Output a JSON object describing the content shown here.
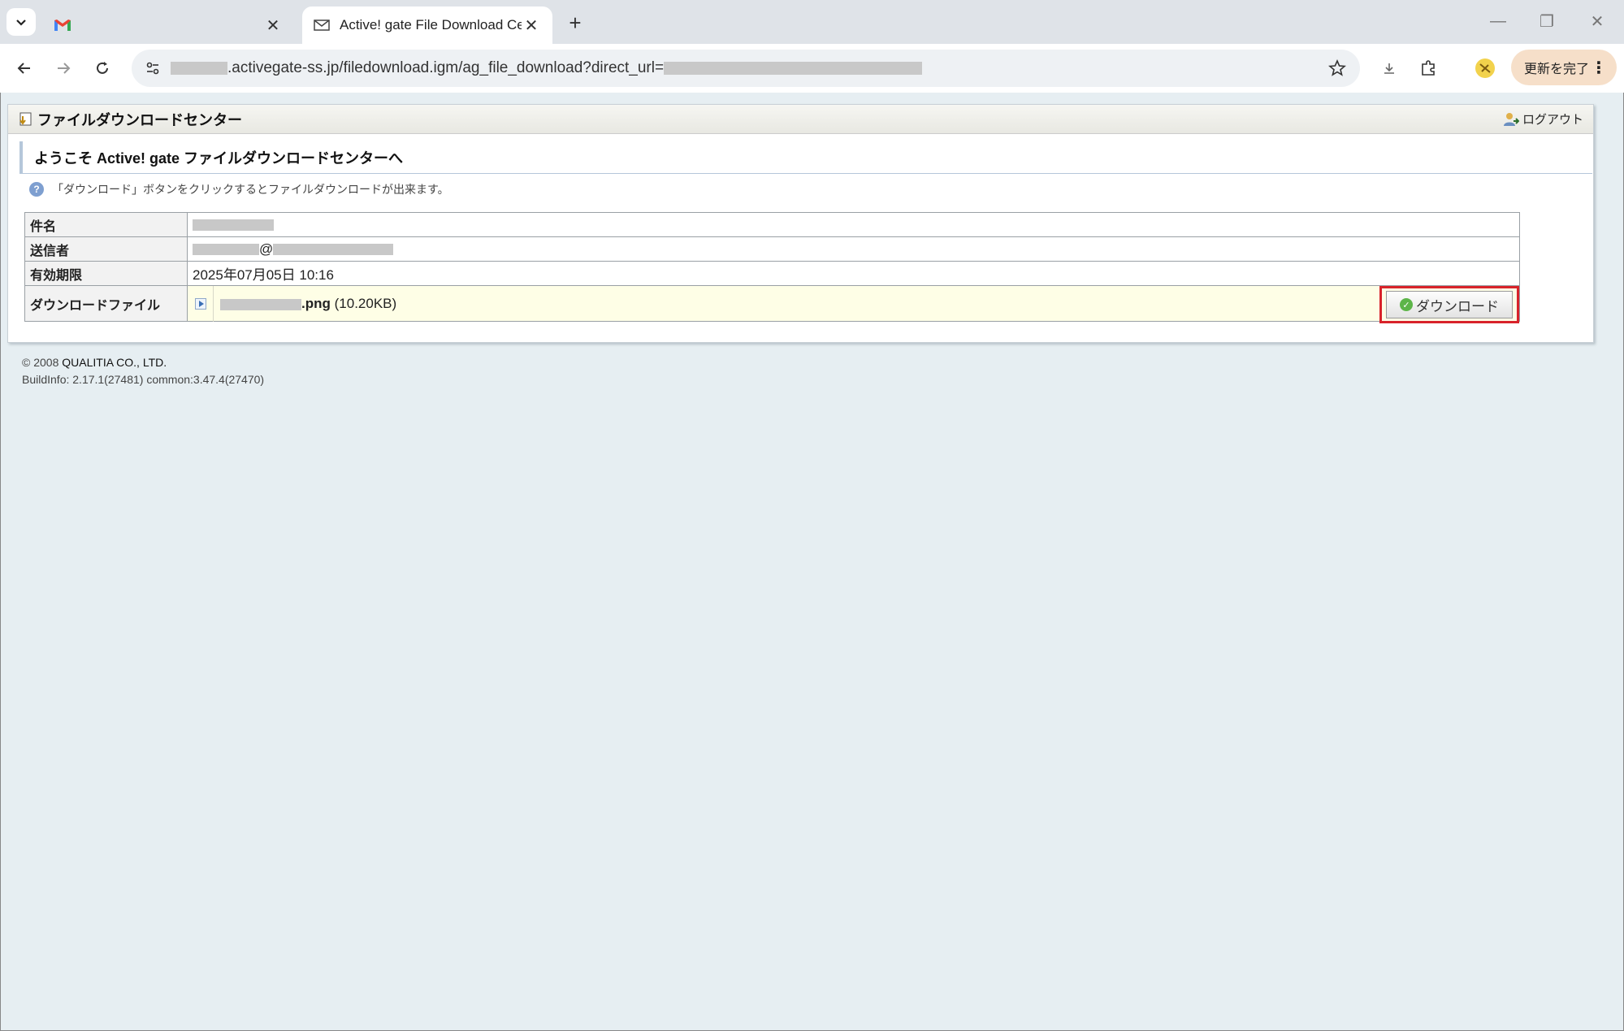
{
  "browser": {
    "tabs": [
      {
        "title": "",
        "icon": "gmail-icon"
      },
      {
        "title": "Active! gate File Download Cen",
        "icon": "mail-icon"
      }
    ],
    "url_domain": ".activegate-ss.jp/filedownload.igm/ag_file_download?direct_url=",
    "update_label": "更新を完了"
  },
  "page": {
    "header_title": "ファイルダウンロードセンター",
    "logout_label": "ログアウト",
    "welcome": "ようこそ Active! gate ファイルダウンロードセンターへ",
    "hint": "「ダウンロード」ボタンをクリックするとファイルダウンロードが出来ます。",
    "rows": {
      "subject_label": "件名",
      "sender_label": "送信者",
      "sender_at": "@",
      "expiry_label": "有効期限",
      "expiry_value": "2025年07月05日 10:16",
      "file_label": "ダウンロードファイル",
      "file_ext": ".png",
      "file_size": "(10.20KB)"
    },
    "download_button": "ダウンロード"
  },
  "footer": {
    "copyright_prefix": "© 2008",
    "company": "QUALITIA CO., LTD.",
    "build": "BuildInfo: 2.17.1(27481) common:3.47.4(27470)"
  },
  "colors": {
    "highlight_border": "#d8232a",
    "page_bg": "#e6eef2",
    "file_row_bg": "#fefee6"
  }
}
